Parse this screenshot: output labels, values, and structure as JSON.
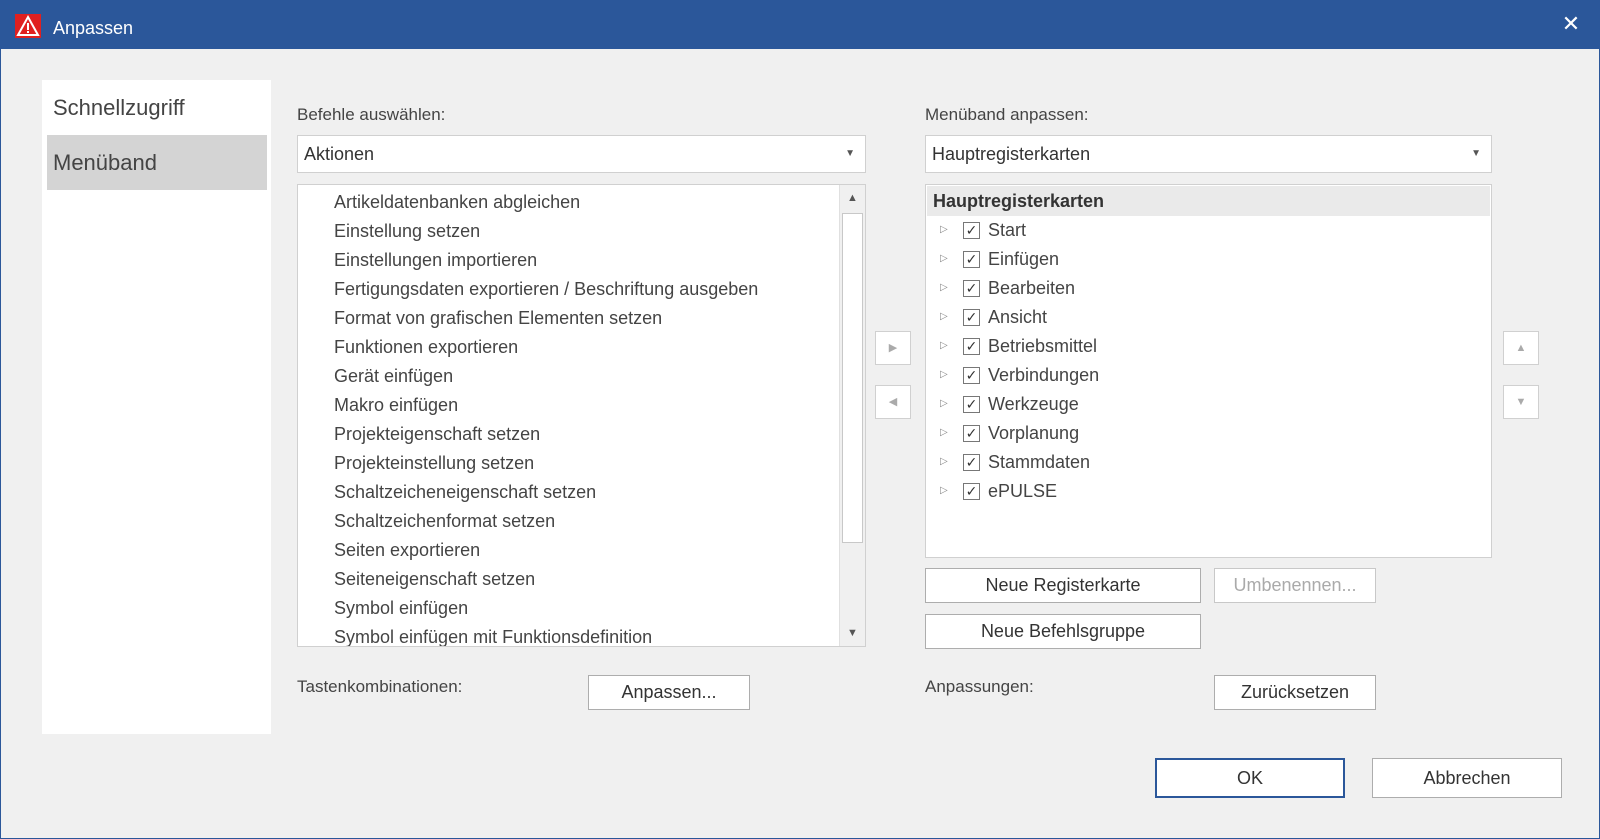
{
  "window": {
    "title": "Anpassen",
    "close_glyph": "✕",
    "app_icon": "warning-triangle-icon"
  },
  "nav": {
    "items": [
      {
        "label": "Schnellzugriff"
      },
      {
        "label": "Menüband"
      }
    ],
    "active": "Menüband"
  },
  "commands": {
    "label": "Befehle auswählen:",
    "combo_value": "Aktionen",
    "items": [
      "Artikeldatenbanken abgleichen",
      "Einstellung setzen",
      "Einstellungen importieren",
      "Fertigungsdaten exportieren / Beschriftung ausgeben",
      "Format von grafischen Elementen setzen",
      "Funktionen exportieren",
      "Gerät einfügen",
      "Makro einfügen",
      "Projekteigenschaft setzen",
      "Projekteinstellung setzen",
      "Schaltzeicheneigenschaft setzen",
      "Schaltzeichenformat setzen",
      "Seiten exportieren",
      "Seiteneigenschaft setzen",
      "Symbol einfügen",
      "Symbol einfügen mit Funktionsdefinition"
    ]
  },
  "ribbon": {
    "label": "Menüband anpassen:",
    "combo_value": "Hauptregisterkarten",
    "tree_header": "Hauptregisterkarten",
    "tabs": [
      {
        "label": "Start",
        "checked": true
      },
      {
        "label": "Einfügen",
        "checked": true
      },
      {
        "label": "Bearbeiten",
        "checked": true
      },
      {
        "label": "Ansicht",
        "checked": true
      },
      {
        "label": "Betriebsmittel",
        "checked": true
      },
      {
        "label": "Verbindungen",
        "checked": true
      },
      {
        "label": "Werkzeuge",
        "checked": true
      },
      {
        "label": "Vorplanung",
        "checked": true
      },
      {
        "label": "Stammdaten",
        "checked": true
      },
      {
        "label": "ePULSE",
        "checked": true
      }
    ],
    "new_tab_label": "Neue Registerkarte",
    "rename_label": "Umbenennen...",
    "new_group_label": "Neue Befehlsgruppe"
  },
  "shortcuts": {
    "label": "Tastenkombinationen:",
    "button_label": "Anpassen..."
  },
  "customizations": {
    "label": "Anpassungen:",
    "reset_label": "Zurücksetzen"
  },
  "footer": {
    "ok_label": "OK",
    "cancel_label": "Abbrechen"
  },
  "colors": {
    "titlebar": "#2b579a",
    "nav_active": "#d4d4d4",
    "window_bg": "#f0f0f0"
  }
}
